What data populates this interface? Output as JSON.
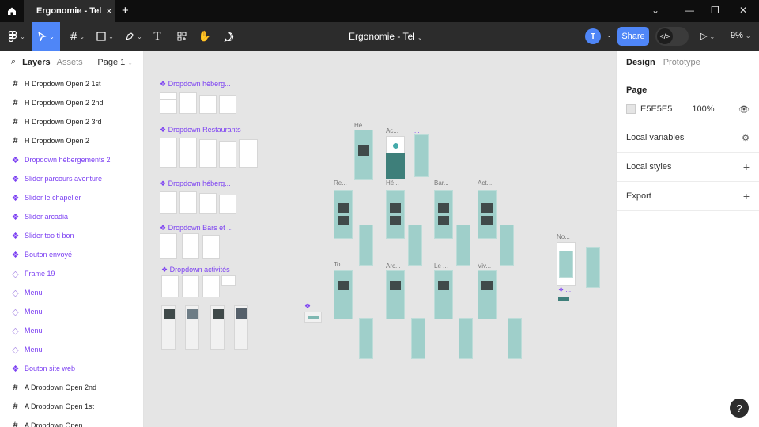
{
  "tabbar": {
    "tab_title": "Ergonomie - Tel",
    "close": "×",
    "new_tab": "+"
  },
  "toolbar": {
    "doc_title": "Ergonomie - Tel",
    "avatar_initial": "T",
    "share_label": "Share",
    "devmode_glyph": "</>",
    "zoom": "9%"
  },
  "left_panel": {
    "tab_layers": "Layers",
    "tab_assets": "Assets",
    "page_select": "Page 1",
    "layers": [
      {
        "label": "H Dropdown Open 2 1st",
        "kind": "frame"
      },
      {
        "label": "H Dropdown Open 2 2nd",
        "kind": "frame"
      },
      {
        "label": "H Dropdown Open 2 3rd",
        "kind": "frame"
      },
      {
        "label": "H Dropdown Open 2",
        "kind": "frame"
      },
      {
        "label": "Dropdown hébergements 2",
        "kind": "component"
      },
      {
        "label": "Slider parcours aventure",
        "kind": "component"
      },
      {
        "label": "Slider le chapelier",
        "kind": "component"
      },
      {
        "label": "Slider arcadia",
        "kind": "component"
      },
      {
        "label": "Slider too ti bon",
        "kind": "component"
      },
      {
        "label": "Bouton envoyé",
        "kind": "component"
      },
      {
        "label": "Frame 19",
        "kind": "instance"
      },
      {
        "label": "Menu",
        "kind": "instance"
      },
      {
        "label": "Menu",
        "kind": "instance"
      },
      {
        "label": "Menu",
        "kind": "instance"
      },
      {
        "label": "Menu",
        "kind": "instance"
      },
      {
        "label": "Bouton site web",
        "kind": "component"
      },
      {
        "label": "A Dropdown Open 2nd",
        "kind": "frame"
      },
      {
        "label": "A Dropdown Open 1st",
        "kind": "frame"
      },
      {
        "label": "A Dropdown Open",
        "kind": "frame"
      }
    ]
  },
  "canvas": {
    "component_labels": [
      "❖ Dropdown héberg...",
      "❖ Dropdown Restaurants",
      "❖ Dropdown héberg...",
      "❖ Dropdown Bars et ...",
      "❖ Dropdown activités",
      "❖ ..."
    ],
    "frame_labels": [
      "Hé...",
      "Ac...",
      "...",
      "Re...",
      "Hé...",
      "Bar...",
      "Act...",
      "No...",
      "To...",
      "Arc...",
      "Le ...",
      "Viv...",
      "❖ ..."
    ]
  },
  "right_panel": {
    "tab_design": "Design",
    "tab_prototype": "Prototype",
    "page_label": "Page",
    "bg_color_hex": "E5E5E5",
    "bg_opacity": "100%",
    "local_variables": "Local variables",
    "local_styles": "Local styles",
    "export": "Export"
  },
  "help": "?",
  "colors": {
    "accent": "#4f86f7",
    "component": "#7b3ff2",
    "canvas_bg": "#e5e5e5",
    "frame_teal": "#9fcfca"
  }
}
